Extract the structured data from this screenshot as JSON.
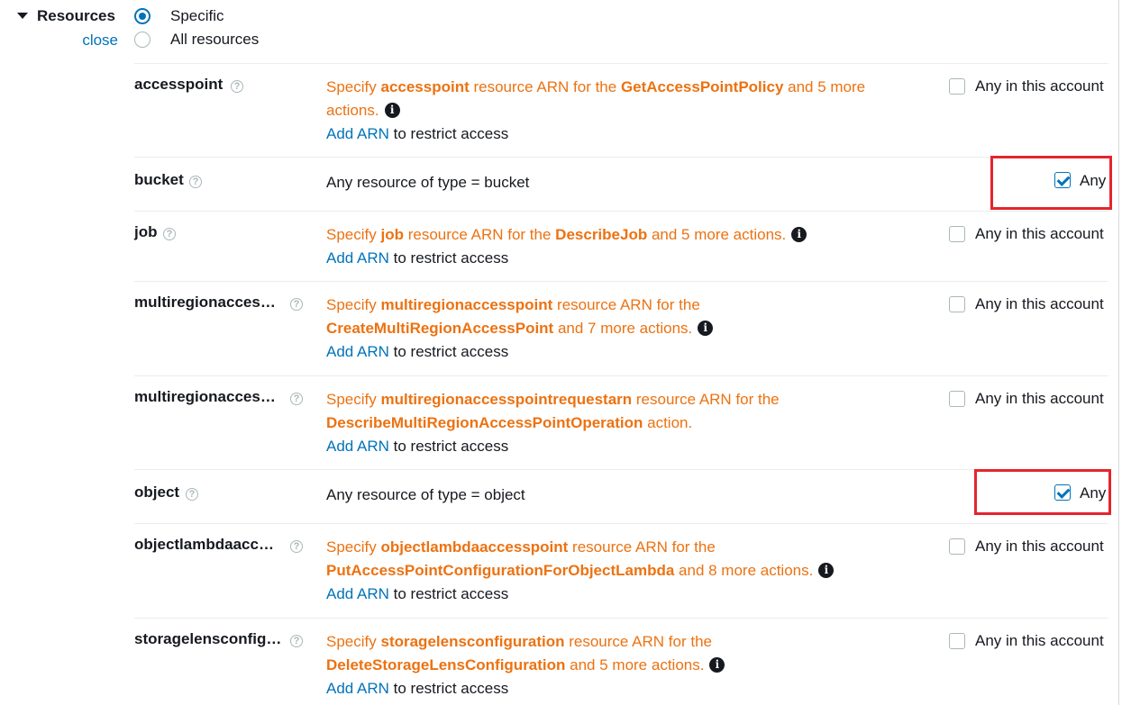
{
  "header": {
    "title": "Resources",
    "close_label": "close",
    "options": [
      {
        "label": "Specific",
        "selected": true
      },
      {
        "label": "All resources",
        "selected": false
      }
    ]
  },
  "help_glyph": "?",
  "info_glyph": "i",
  "rows": [
    {
      "name": "accesspoint",
      "desc": {
        "pre": "Specify ",
        "res": "accesspoint",
        "mid": " resource ARN for the ",
        "action": "GetAccessPointPolicy",
        "post": " and 5 more actions."
      },
      "add_arn": "Add ARN",
      "restrict": " to restrict access",
      "check_label": "Any in this account",
      "checked": false
    },
    {
      "name": "bucket",
      "plain_desc": "Any resource of type = bucket",
      "check_label": "Any",
      "checked": true
    },
    {
      "name": "job",
      "desc": {
        "pre": "Specify ",
        "res": "job",
        "mid": " resource ARN for the ",
        "action": "DescribeJob",
        "post": " and 5 more actions."
      },
      "add_arn": "Add ARN",
      "restrict": " to restrict access",
      "check_label": "Any in this account",
      "checked": false
    },
    {
      "name": "multiregionacces…",
      "desc": {
        "pre": "Specify ",
        "res": "multiregionaccesspoint",
        "mid": " resource ARN for the ",
        "action": "CreateMultiRegionAccessPoint",
        "post": " and 7 more actions."
      },
      "add_arn": "Add ARN",
      "restrict": " to restrict access",
      "check_label": "Any in this account",
      "checked": false
    },
    {
      "name": "multiregionacces…",
      "desc": {
        "pre": "Specify ",
        "res": "multiregionaccesspointrequestarn",
        "mid": " resource ARN for the ",
        "action": "DescribeMultiRegionAccessPointOperation",
        "post": " action."
      },
      "add_arn": "Add ARN",
      "restrict": " to restrict access",
      "check_label": "Any in this account",
      "checked": false
    },
    {
      "name": "object",
      "plain_desc": "Any resource of type = object",
      "check_label": "Any",
      "checked": true
    },
    {
      "name": "objectlambdaacc…",
      "desc": {
        "pre": "Specify ",
        "res": "objectlambdaaccesspoint",
        "mid": " resource ARN for the ",
        "action": "PutAccessPointConfigurationForObjectLambda",
        "post": " and 8 more actions."
      },
      "add_arn": "Add ARN",
      "restrict": " to restrict access",
      "check_label": "Any in this account",
      "checked": false
    },
    {
      "name": "storagelensconfig…",
      "desc": {
        "pre": "Specify ",
        "res": "storagelensconfiguration",
        "mid": " resource ARN for the ",
        "action": "DeleteStorageLensConfiguration",
        "post": " and 5 more actions."
      },
      "add_arn": "Add ARN",
      "restrict": " to restrict access",
      "check_label": "Any in this account",
      "checked": false
    }
  ]
}
